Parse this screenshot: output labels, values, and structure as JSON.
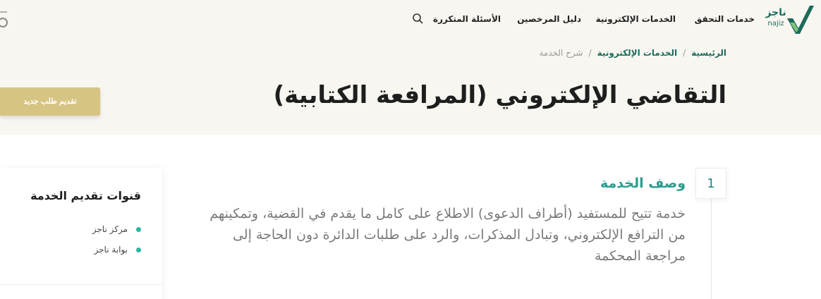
{
  "header": {
    "logo_text": "ناجز",
    "logo_sub": "najiz",
    "nav": [
      {
        "label": "خدمات التحقق"
      },
      {
        "label": "الخدمات الإلكترونية"
      },
      {
        "label": "دليل المرخصين"
      },
      {
        "label": "الأسئلة المتكررة"
      }
    ]
  },
  "breadcrumb": {
    "home": "الرئيسية",
    "section": "الخدمات الإلكترونية",
    "current": "شرح الخدمة",
    "separator": "/"
  },
  "page": {
    "title": "التقاضي الإلكتروني (المرافعة الكتابية)",
    "new_request_label": "تقديم طلب جديد"
  },
  "service": {
    "step_number": "1",
    "heading": "وصف الخدمة",
    "description": "خدمة تتيح للمستفيد (أطراف الدعوى) الاطلاع على كامل ما يقدم في القضية، وتمكينهم من الترافع الإلكتروني، وتبادل المذكرات، والرد على طلبات الدائرة دون الحاجة إلى مراجعة المحكمة"
  },
  "sidebar": {
    "title": "قنوات تقديم الخدمة",
    "channels": [
      {
        "label": "مركز ناجز"
      },
      {
        "label": "بوابة ناجز"
      }
    ]
  },
  "colors": {
    "brand_green": "#1b6b5c",
    "accent_teal": "#2a9d8f",
    "gold_button": "#d6c483",
    "header_bg": "#f8f6f1"
  }
}
